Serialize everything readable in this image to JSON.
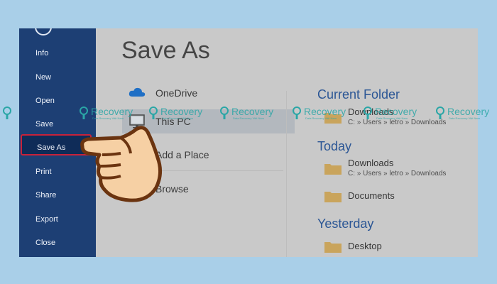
{
  "sidebar": {
    "items": [
      {
        "label": "Info"
      },
      {
        "label": "New"
      },
      {
        "label": "Open"
      },
      {
        "label": "Save"
      },
      {
        "label": "Save As",
        "active": true
      },
      {
        "label": "Print"
      },
      {
        "label": "Share"
      },
      {
        "label": "Export"
      },
      {
        "label": "Close"
      }
    ]
  },
  "main": {
    "title": "Save As",
    "locations": [
      {
        "label": "OneDrive",
        "icon": "onedrive-cloud-icon"
      },
      {
        "label": "This PC",
        "icon": "computer-monitor-icon",
        "selected": true
      },
      {
        "label": "Add a Place",
        "icon": "add-place-globe-icon"
      },
      {
        "label": "Browse",
        "icon": "browse-folder-icon"
      }
    ]
  },
  "recent": {
    "current_folder": {
      "heading": "Current Folder",
      "items": [
        {
          "name": "Downloads",
          "path": "C: » Users » letro » Downloads"
        }
      ]
    },
    "today": {
      "heading": "Today",
      "items": [
        {
          "name": "Downloads",
          "path": "C: » Users » letro » Downloads"
        },
        {
          "name": "Documents"
        }
      ]
    },
    "yesterday": {
      "heading": "Yesterday",
      "items": [
        {
          "name": "Desktop"
        }
      ]
    }
  },
  "watermark": {
    "text": "Recovery",
    "subtext": "Data Recovery Việt Nam"
  },
  "colors": {
    "sidebar": "#1d3f74",
    "accent": "#2b5695",
    "highlight_border": "#c8223a",
    "folder": "#c9a45c"
  }
}
